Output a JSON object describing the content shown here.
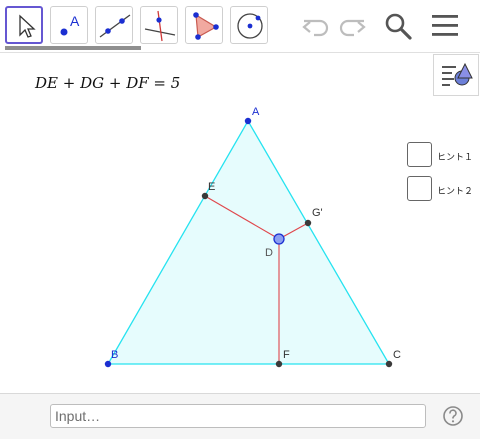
{
  "toolbar": {
    "tools": [
      {
        "name": "move-tool",
        "icon": "arrow-cursor-icon",
        "selected": true
      },
      {
        "name": "point-tool",
        "icon": "point-icon",
        "label": "A"
      },
      {
        "name": "line-tool",
        "icon": "line-icon"
      },
      {
        "name": "perpendicular-tool",
        "icon": "perpendicular-line-icon"
      },
      {
        "name": "polygon-tool",
        "icon": "polygon-icon"
      },
      {
        "name": "circle-tool",
        "icon": "circle-icon"
      }
    ],
    "undo_icon": "undo-icon",
    "redo_icon": "redo-icon",
    "search_icon": "search-icon",
    "menu_icon": "hamburger-menu-icon"
  },
  "formula": "DE + DG + DF = 5",
  "checkboxes": [
    {
      "label": "ヒント１",
      "checked": false
    },
    {
      "label": "ヒント２",
      "checked": false
    }
  ],
  "points": {
    "A": "A",
    "B": "B",
    "C": "C",
    "D": "D",
    "E": "E",
    "F": "F",
    "G": "G'"
  },
  "input_bar": {
    "placeholder": "Input…"
  },
  "colors": {
    "triangle_edge": "#26e3f0",
    "triangle_fill": "#e6fcfd",
    "segment": "#e0474c",
    "point_blue": "#1b2fd1",
    "point_dark": "#3a3a3a",
    "selected_border": "#6557d2"
  }
}
